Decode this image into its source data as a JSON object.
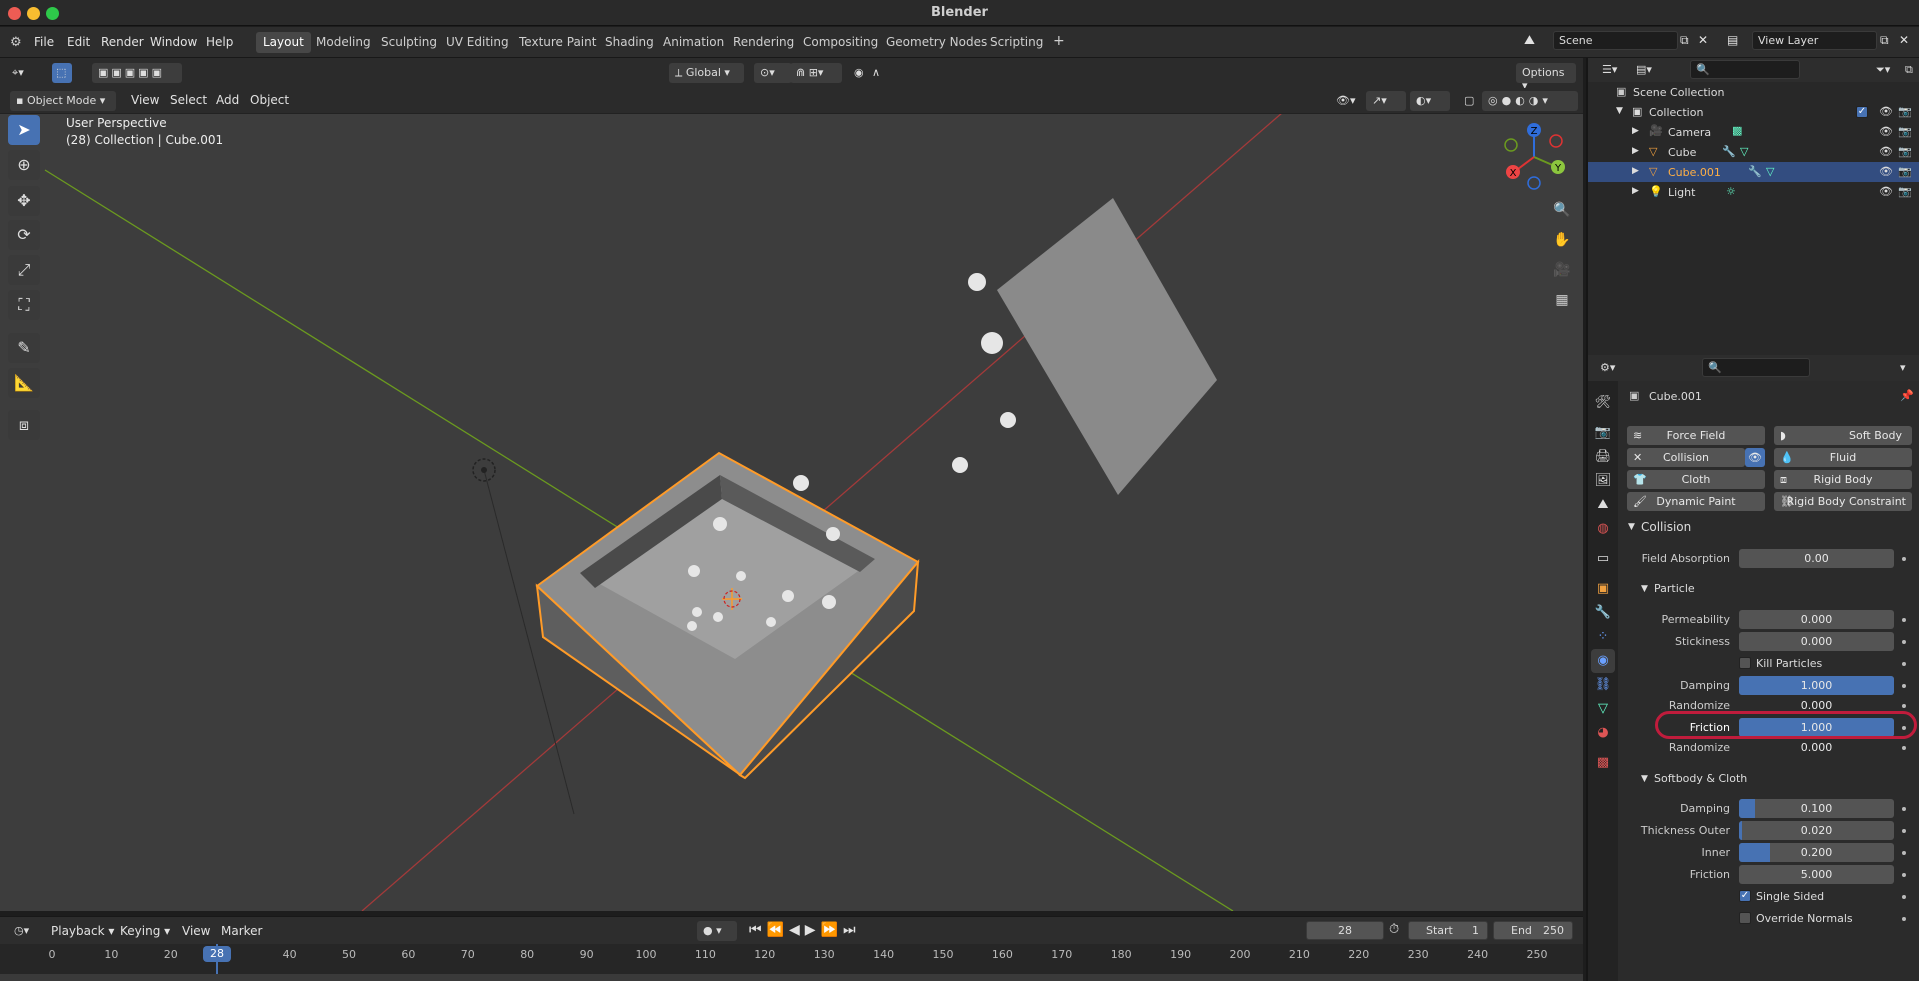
{
  "window": {
    "title": "Blender"
  },
  "menu": [
    "File",
    "Edit",
    "Render",
    "Window",
    "Help"
  ],
  "workspaces": [
    {
      "label": "Layout",
      "active": true
    },
    {
      "label": "Modeling"
    },
    {
      "label": "Sculpting"
    },
    {
      "label": "UV Editing"
    },
    {
      "label": "Texture Paint"
    },
    {
      "label": "Shading"
    },
    {
      "label": "Animation"
    },
    {
      "label": "Rendering"
    },
    {
      "label": "Compositing"
    },
    {
      "label": "Geometry Nodes"
    },
    {
      "label": "Scripting"
    }
  ],
  "scene": {
    "name": "Scene",
    "view_layer": "View Layer"
  },
  "viewport": {
    "mode": "Object Mode",
    "menus": [
      "View",
      "Select",
      "Add",
      "Object"
    ],
    "orientation": "Global",
    "options_label": "Options",
    "overlay_line1": "User Perspective",
    "overlay_line2": "(28) Collection | Cube.001",
    "gizmo": {
      "x": "X",
      "y": "Y",
      "z": "Z"
    }
  },
  "outliner": {
    "root": "Scene Collection",
    "collection": "Collection",
    "items": [
      {
        "label": "Camera"
      },
      {
        "label": "Cube"
      },
      {
        "label": "Cube.001",
        "selected": true
      },
      {
        "label": "Light"
      }
    ]
  },
  "properties": {
    "object_name": "Cube.001",
    "physics_buttons": {
      "force_field": "Force Field",
      "soft_body": "Soft Body",
      "collision": "Collision",
      "fluid": "Fluid",
      "cloth": "Cloth",
      "rigid_body": "Rigid Body",
      "dynamic_paint": "Dynamic Paint",
      "rigid_body_constraint": "Rigid Body Constraint"
    },
    "collision_panel": {
      "title": "Collision",
      "field_absorption_label": "Field Absorption",
      "field_absorption": "0.00",
      "particle_title": "Particle",
      "permeability_label": "Permeability",
      "permeability": "0.000",
      "stickiness_label": "Stickiness",
      "stickiness": "0.000",
      "kill_particles_label": "Kill Particles",
      "damping_label": "Damping",
      "damping": "1.000",
      "damping_fill": 1.0,
      "randomize_label": "Randomize",
      "damping_randomize": "0.000",
      "friction_label": "Friction",
      "friction": "1.000",
      "friction_fill": 1.0,
      "friction_randomize": "0.000",
      "softbody_title": "Softbody & Cloth",
      "sb_damping": "0.100",
      "sb_damping_fill": 0.1,
      "thickness_outer_label": "Thickness Outer",
      "thickness_outer": "0.020",
      "thickness_outer_fill": 0.02,
      "inner_label": "Inner",
      "inner": "0.200",
      "inner_fill": 0.2,
      "sb_friction": "5.000",
      "single_sided_label": "Single Sided",
      "override_normals_label": "Override Normals"
    }
  },
  "timeline": {
    "menus": [
      "Playback",
      "Keying",
      "View",
      "Marker"
    ],
    "current_frame": "28",
    "start_label": "Start",
    "start": "1",
    "end_label": "End",
    "end": "250",
    "ruler": [
      "0",
      "10",
      "20",
      "28",
      "40",
      "50",
      "60",
      "70",
      "80",
      "90",
      "100",
      "110",
      "120",
      "130",
      "140",
      "150",
      "160",
      "170",
      "180",
      "190",
      "200",
      "210",
      "220",
      "230",
      "240",
      "250"
    ]
  },
  "colors": {
    "accent": "#4772b3",
    "selection": "#ff9b28",
    "highlight_circle": "#c01c3c",
    "x_axis": "#a23a3a",
    "y_axis": "#6b9a1f"
  }
}
